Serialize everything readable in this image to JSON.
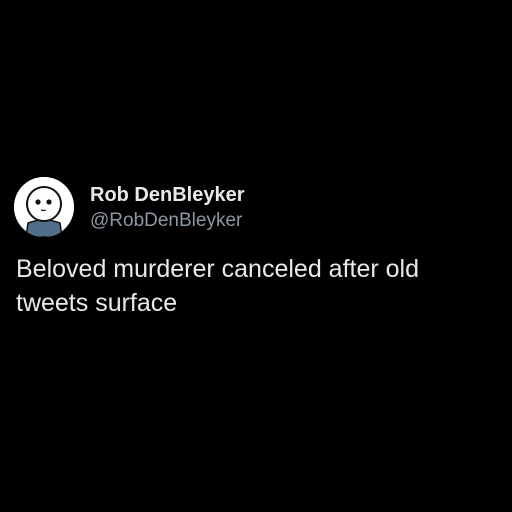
{
  "tweet": {
    "author": {
      "display_name": "Rob DenBleyker",
      "handle": "@RobDenBleyker",
      "avatar_icon": "cyanide-happiness-character-avatar"
    },
    "text": "Beloved murderer canceled after old tweets surface"
  },
  "colors": {
    "background": "#000000",
    "primary_text": "#e7e9ea",
    "secondary_text": "#8b98a5",
    "avatar_shirt": "#4e6e8a"
  }
}
